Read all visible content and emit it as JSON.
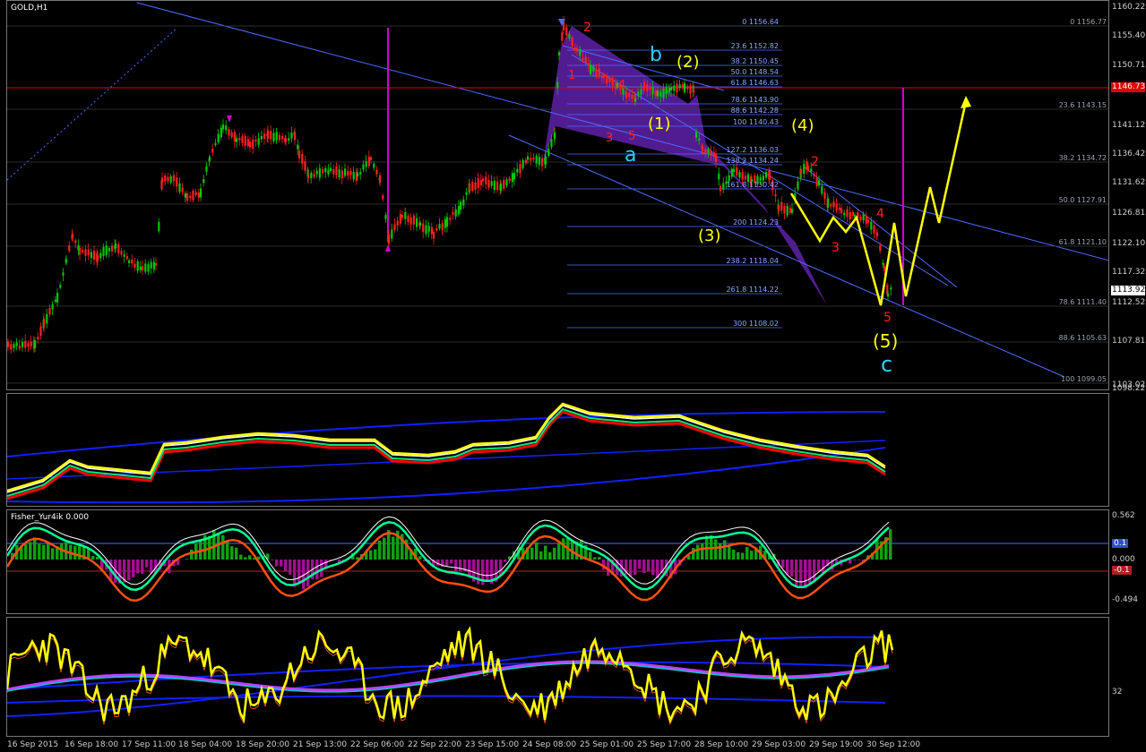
{
  "main": {
    "title": "GOLD,H1",
    "current_price": "1113.92",
    "red_line_price": "1146.73",
    "price_scale": [
      "1160.22",
      "1155.40",
      "1150.71",
      "1146.73",
      "1141.12",
      "1136.42",
      "1131.62",
      "1126.81",
      "1122.10",
      "1117.32",
      "1113.92",
      "1112.52",
      "1107.81",
      "1103.02",
      "1098.22"
    ],
    "fib_left": [
      "0 1156.64",
      "23.6 1152.82",
      "38.2 1150.45",
      "50.0 1148.54",
      "61.8 1146.63",
      "78.6 1143.90",
      "88.6 1142.28",
      "100 1140.43",
      "127.2 1136.03",
      "138.2 1134.24",
      "161.8 1130.42",
      "200 1124.23",
      "238.2 1118.04",
      "261.8 1114.22",
      "300 1108.02"
    ],
    "fib_right": [
      "0 1156.77",
      "23.6 1143.15",
      "38.2 1134.72",
      "50.0 1127.91",
      "61.8 1121.10",
      "78.6 1111.40",
      "88.6 1105.63",
      "100 1099.05"
    ],
    "wave_labels": {
      "red_2_top": "2",
      "red_1": "1",
      "red_4": "4",
      "red_3": "3",
      "red_5": "5",
      "b": "b",
      "a": "a",
      "y2": "(2)",
      "y1": "(1)",
      "y3": "(3)",
      "y4": "(4)",
      "r2b": "2",
      "r3b": "3",
      "r4b": "4",
      "r5b": "5",
      "y5": "(5)",
      "c": "c"
    }
  },
  "indicator2": {
    "title": "Fisher_Yur4ik 0.000",
    "scale": [
      "0.562",
      "0.1",
      "0.000",
      "-0.1",
      "-0.494"
    ]
  },
  "indicator3": {
    "scale": [
      "32"
    ]
  },
  "x_axis": [
    "16 Sep 2015",
    "16 Sep 18:00",
    "17 Sep 11:00",
    "18 Sep 04:00",
    "18 Sep 20:00",
    "21 Sep 13:00",
    "22 Sep 06:00",
    "22 Sep 22:00",
    "23 Sep 15:00",
    "24 Sep 08:00",
    "25 Sep 01:00",
    "25 Sep 17:00",
    "28 Sep 10:00",
    "29 Sep 03:00",
    "29 Sep 19:00",
    "30 Sep 12:00"
  ],
  "colors": {
    "bull": "#00c800",
    "bear": "#ff2020",
    "fib": "#4d6bff",
    "yellow": "#ffff00",
    "magenta": "#d000d0",
    "cyan": "#33ccff",
    "purple": "#5a1fa0"
  }
}
